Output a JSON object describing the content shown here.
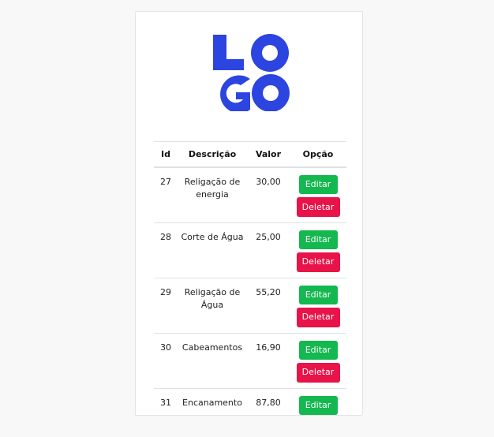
{
  "brand": {
    "logo_text": "LOGO",
    "logo_color": "#2c44e0"
  },
  "table": {
    "headers": [
      "Id",
      "Descrição",
      "Valor",
      "Opção"
    ],
    "rows": [
      {
        "id": "27",
        "descricao": "Religação de energia",
        "valor": "30,00"
      },
      {
        "id": "28",
        "descricao": "Corte de Água",
        "valor": "25,00"
      },
      {
        "id": "29",
        "descricao": "Religação de Água",
        "valor": "55,20"
      },
      {
        "id": "30",
        "descricao": "Cabeamentos",
        "valor": "16,90"
      },
      {
        "id": "31",
        "descricao": "Encanamento",
        "valor": "87,80"
      }
    ],
    "edit_label": "Editar",
    "delete_label": "Deletar"
  },
  "colors": {
    "edit_button": "#13b84f",
    "delete_button": "#e81348"
  }
}
